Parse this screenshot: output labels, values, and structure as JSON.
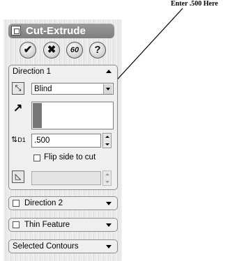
{
  "annotation": {
    "text": "Enter .500 Here"
  },
  "panel": {
    "title": "Cut-Extrude",
    "buttons": [
      {
        "name": "ok",
        "glyph": "✔"
      },
      {
        "name": "cancel",
        "glyph": "✖"
      },
      {
        "name": "detail-preview",
        "glyph": "60"
      },
      {
        "name": "help",
        "glyph": "?"
      }
    ]
  },
  "direction1": {
    "header": "Direction 1",
    "end_condition": "Blind",
    "depth_icon_label": "D1",
    "depth_value": ".500",
    "flip_label": "Flip side to cut",
    "flip_checked": false,
    "draft_value": ""
  },
  "direction2": {
    "header": "Direction 2",
    "checked": false
  },
  "thin_feature": {
    "header": "Thin Feature",
    "checked": false
  },
  "selected_contours": {
    "header": "Selected Contours"
  }
}
